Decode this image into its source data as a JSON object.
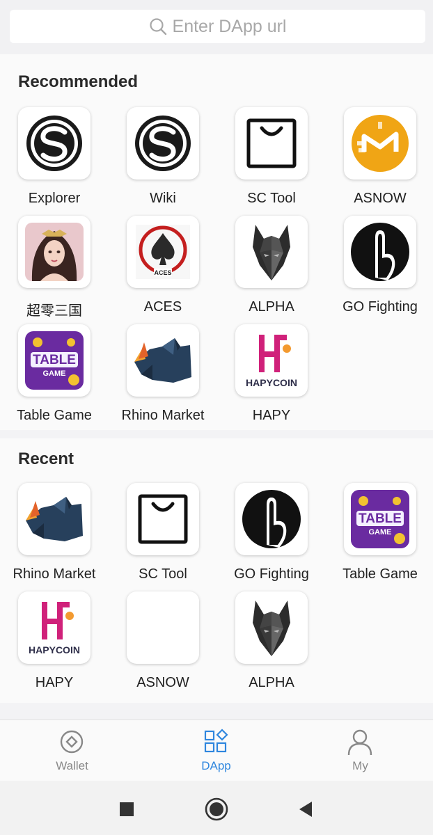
{
  "search": {
    "placeholder": "Enter DApp url"
  },
  "sections": {
    "recommended": {
      "title": "Recommended",
      "apps": [
        "Explorer",
        "Wiki",
        "SC Tool",
        "ASNOW",
        "超零三国",
        "ACES",
        "ALPHA",
        "GO Fighting",
        "Table Game",
        "Rhino Market",
        "HAPY"
      ]
    },
    "recent": {
      "title": "Recent",
      "apps": [
        "Rhino Market",
        "SC Tool",
        "GO Fighting",
        "Table Game",
        "HAPY",
        "ASNOW",
        "ALPHA"
      ]
    }
  },
  "icons": {
    "explorer": "s-logo-icon",
    "wiki": "s-logo-icon",
    "sc_tool": "shopping-bag-icon",
    "asnow": "asnow-logo-icon",
    "chaoling": "game-avatar-icon",
    "aces": "aces-spade-icon",
    "alpha": "wolf-icon",
    "go_fighting": "finger-icon",
    "table_game": "table-game-logo-icon",
    "rhino": "rhino-icon",
    "hapy": "hapycoin-logo-icon",
    "hapy_text": "HAPYCOIN",
    "table_text": "TABLE",
    "game_text": "GAME",
    "aces_text": "ACES"
  },
  "nav": {
    "wallet": "Wallet",
    "dapp": "DApp",
    "my": "My"
  },
  "colors": {
    "accent": "#2e86de",
    "asnow_gold": "#f0a515",
    "hapy_pink": "#d0217a",
    "table_purple": "#6a2ba0"
  }
}
